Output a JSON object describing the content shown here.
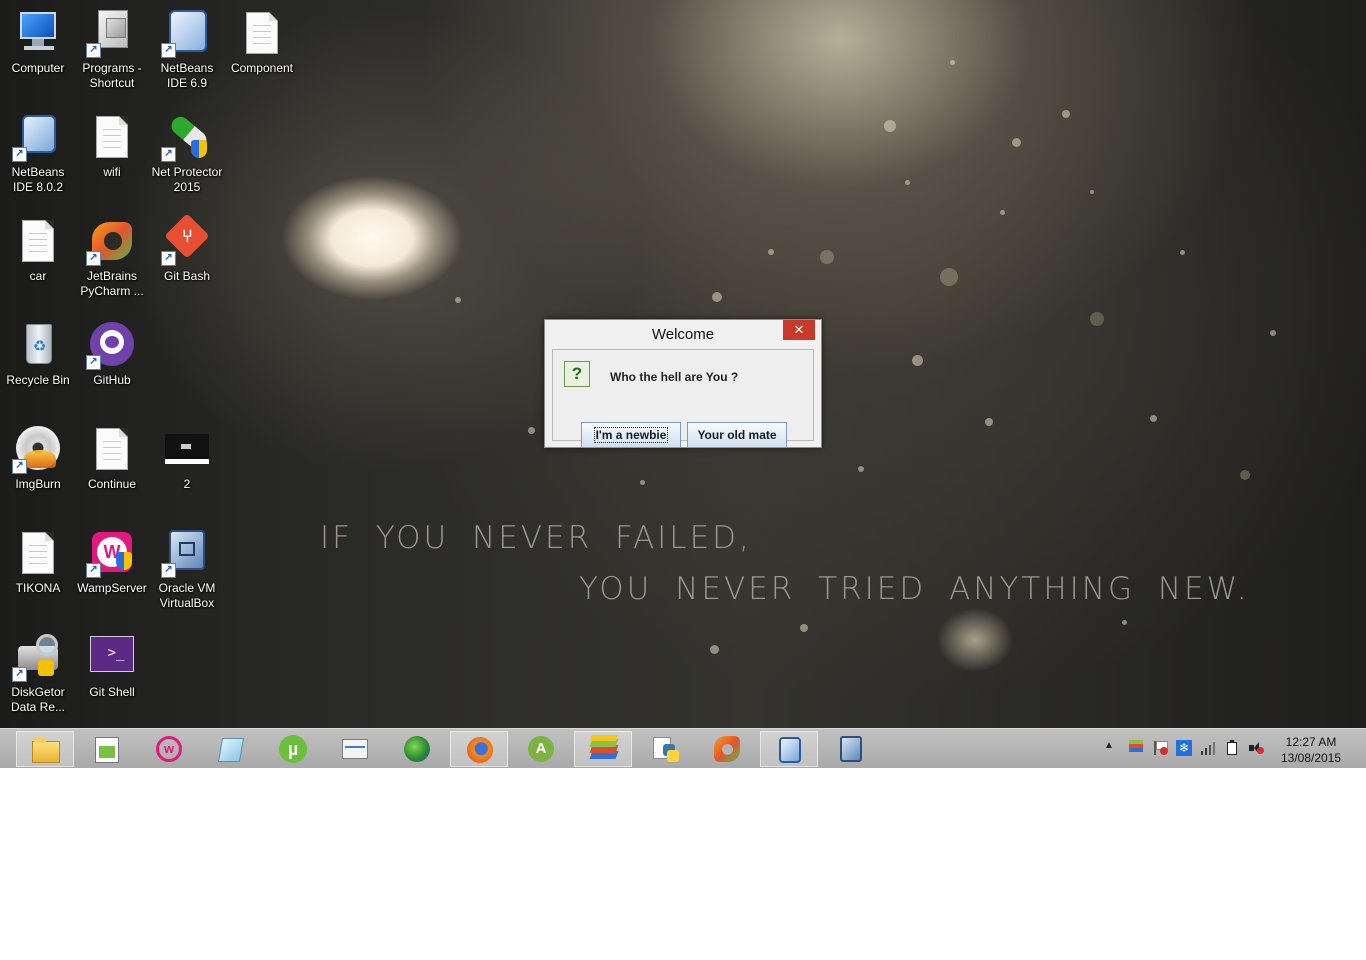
{
  "desktop": {
    "quote_line1": "IF YOU NEVER FAILED,",
    "quote_line2": "YOU NEVER TRIED ANYTHING NEW.",
    "icons": [
      {
        "label": "Computer"
      },
      {
        "label": "Programs - Shortcut"
      },
      {
        "label": "NetBeans IDE 6.9"
      },
      {
        "label": "Component"
      },
      {
        "label": "NetBeans IDE 8.0.2"
      },
      {
        "label": "wifi"
      },
      {
        "label": "Net Protector 2015"
      },
      {
        "label": "car"
      },
      {
        "label": "JetBrains PyCharm ..."
      },
      {
        "label": "Git Bash"
      },
      {
        "label": "Recycle Bin"
      },
      {
        "label": "GitHub"
      },
      {
        "label": "ImgBurn"
      },
      {
        "label": "Continue"
      },
      {
        "label": "2"
      },
      {
        "label": "TIKONA"
      },
      {
        "label": "WampServer"
      },
      {
        "label": "Oracle VM VirtualBox"
      },
      {
        "label": "DiskGetor Data Re..."
      },
      {
        "label": "Git Shell"
      }
    ]
  },
  "dialog": {
    "title": "Welcome",
    "close_glyph": "✕",
    "question_glyph": "?",
    "message": "Who the hell are You ?",
    "btn_newbie": "I'm a newbie",
    "btn_oldmate": "Your old mate"
  },
  "taskbar": {
    "apps": [
      "file-explorer",
      "notepad-plus-plus",
      "wampserver",
      "notepad",
      "utorrent",
      "task-manager",
      "internet-download-manager",
      "firefox",
      "android-studio",
      "bluestacks",
      "python",
      "pycharm",
      "netbeans",
      "virtualbox"
    ],
    "time": "12:27 AM",
    "date": "13/08/2015"
  },
  "colors": {
    "close_button": "#c7392b",
    "taskbar": "#b4b4b4",
    "button_border": "#7a9cc6"
  }
}
